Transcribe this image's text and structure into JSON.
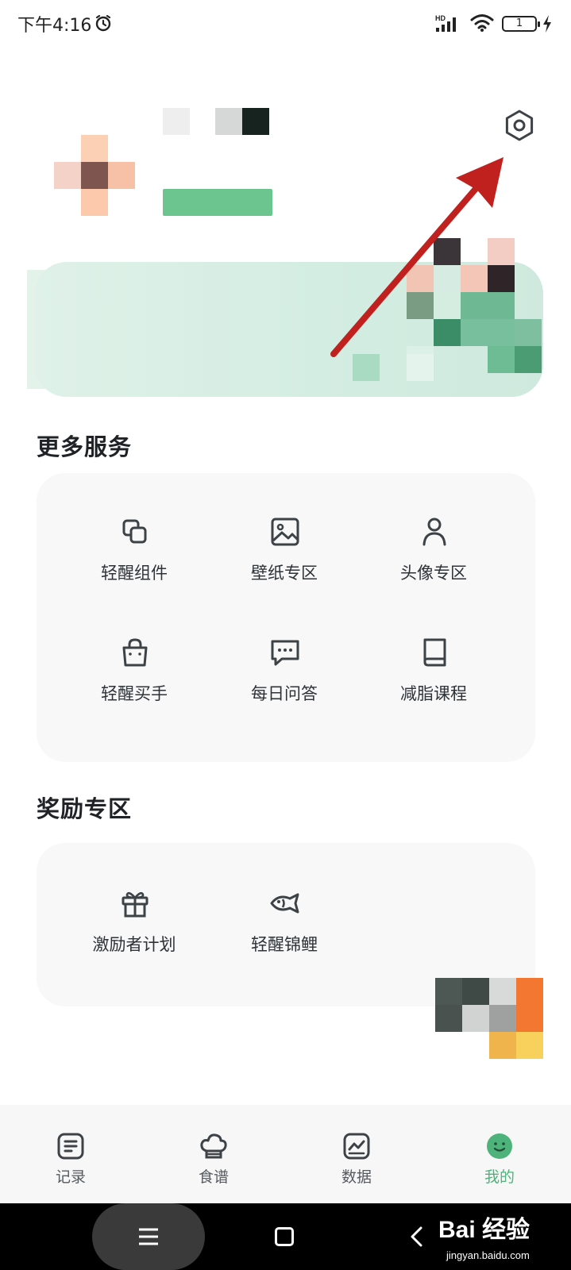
{
  "status_bar": {
    "time": "下午4:16",
    "network_label": "HD",
    "battery": "1"
  },
  "profile": {
    "settings_icon": "gear-icon"
  },
  "services": {
    "title": "更多服务",
    "items": [
      {
        "label": "轻醒组件",
        "icon": "widget-squares-icon"
      },
      {
        "label": "壁纸专区",
        "icon": "image-icon"
      },
      {
        "label": "头像专区",
        "icon": "person-icon"
      },
      {
        "label": "轻醒买手",
        "icon": "shopping-bag-icon"
      },
      {
        "label": "每日问答",
        "icon": "chat-bubble-icon"
      },
      {
        "label": "减脂课程",
        "icon": "book-icon"
      }
    ]
  },
  "rewards": {
    "title": "奖励专区",
    "items": [
      {
        "label": "激励者计划",
        "icon": "gift-icon"
      },
      {
        "label": "轻醒锦鲤",
        "icon": "fish-icon"
      }
    ]
  },
  "bottom_nav": {
    "items": [
      {
        "label": "记录",
        "icon": "record-list-icon"
      },
      {
        "label": "食谱",
        "icon": "chef-hat-icon"
      },
      {
        "label": "数据",
        "icon": "chart-line-icon"
      },
      {
        "label": "我的",
        "icon": "smiley-face-icon"
      }
    ],
    "active_index": 3
  },
  "watermark": {
    "brand": "Bai 经验",
    "url": "jingyan.baidu.com"
  },
  "colors": {
    "accent": "#4db37a",
    "annotation_arrow": "#c0211f",
    "banner_bg": "#d4ede2",
    "card_bg": "#f7f8f7"
  }
}
